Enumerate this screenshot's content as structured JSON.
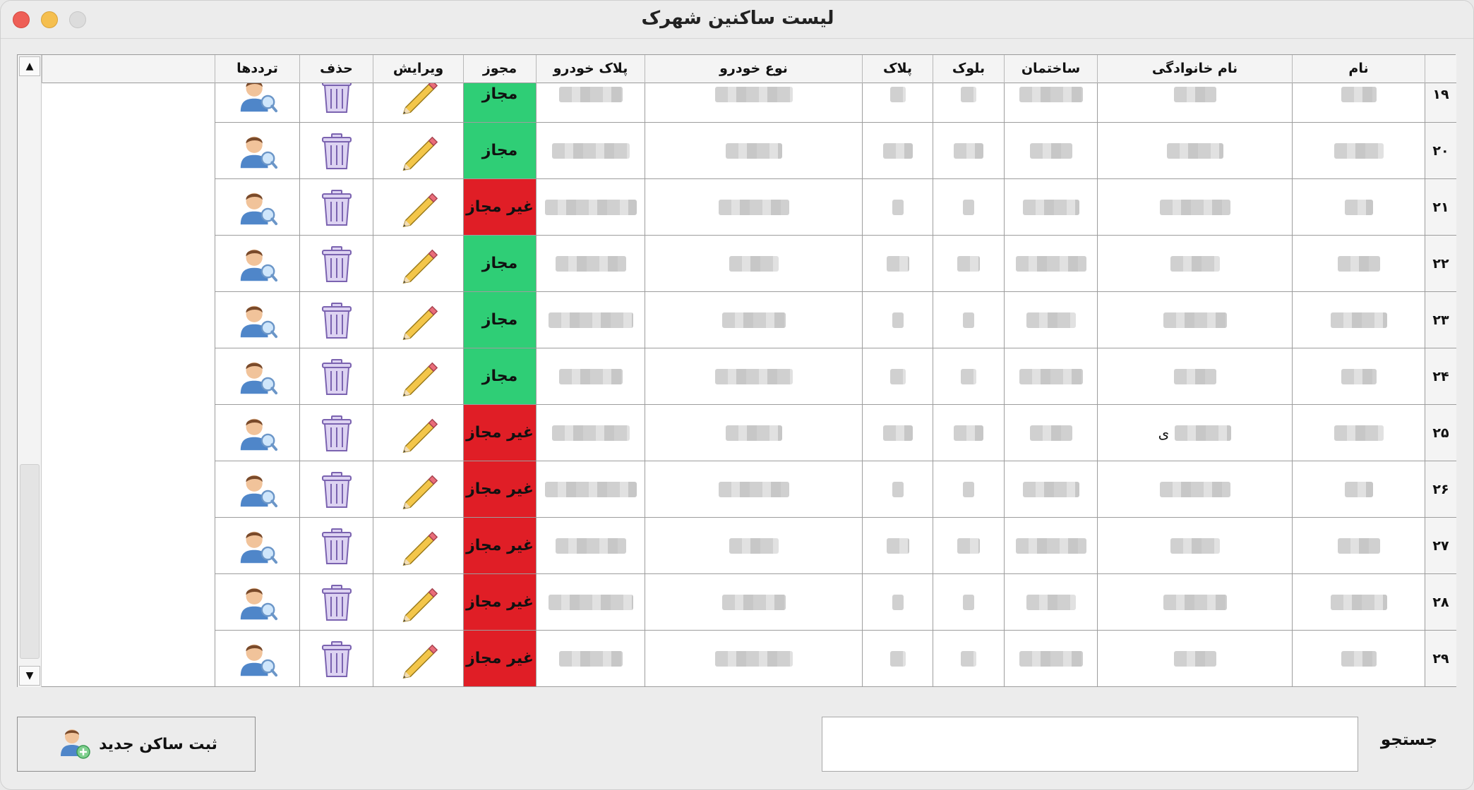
{
  "window": {
    "title": "لیست ساکنین شهرک"
  },
  "table": {
    "headers": {
      "name": "نام",
      "family": "نام خانوادگی",
      "building": "ساختمان",
      "block": "بلوک",
      "plate": "پلاک",
      "car_type": "نوع خودرو",
      "car_plate": "پلاک خودرو",
      "permit": "مجوز",
      "edit": "ویرایش",
      "delete": "حذف",
      "traffic": "ترددها"
    },
    "rows": [
      {
        "num": "۱۹",
        "permit": "مجاز",
        "allowed": true
      },
      {
        "num": "۲۰",
        "permit": "مجاز",
        "allowed": true
      },
      {
        "num": "۲۱",
        "permit": "غیر مجاز",
        "allowed": false
      },
      {
        "num": "۲۲",
        "permit": "مجاز",
        "allowed": true
      },
      {
        "num": "۲۳",
        "permit": "مجاز",
        "allowed": true
      },
      {
        "num": "۲۴",
        "permit": "مجاز",
        "allowed": true
      },
      {
        "num": "۲۵",
        "permit": "غیر مجاز",
        "allowed": false
      },
      {
        "num": "۲۶",
        "permit": "غیر مجاز",
        "allowed": false
      },
      {
        "num": "۲۷",
        "permit": "غیر مجاز",
        "allowed": false
      },
      {
        "num": "۲۸",
        "permit": "غیر مجاز",
        "allowed": false
      },
      {
        "num": "۲۹",
        "permit": "غیر مجاز",
        "allowed": false
      }
    ],
    "row_25_family_fragment": "ی"
  },
  "colors": {
    "allowed": "#2fce76",
    "not_allowed": "#e01e26"
  },
  "icons": {
    "edit": "pencil-icon",
    "delete": "trash-icon",
    "traffic": "user-search-icon",
    "add": "user-add-icon"
  },
  "footer": {
    "add_button_label": "ثبت ساکن جدید",
    "search_label": "جستجو",
    "search_value": ""
  }
}
